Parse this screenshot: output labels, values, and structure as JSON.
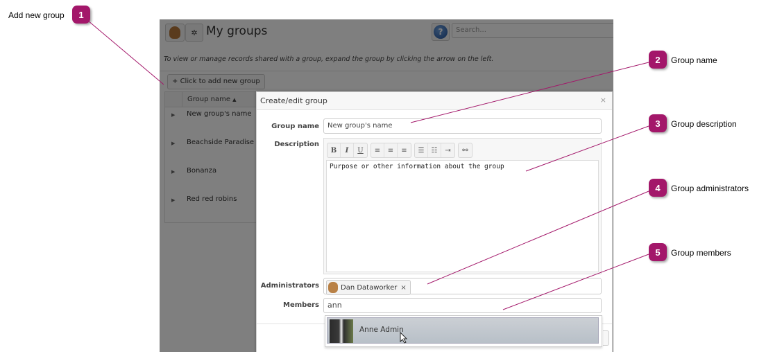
{
  "callouts": [
    {
      "number": "1",
      "label": "Add new group"
    },
    {
      "number": "2",
      "label": "Group name"
    },
    {
      "number": "3",
      "label": "Group description"
    },
    {
      "number": "4",
      "label": "Group administrators"
    },
    {
      "number": "5",
      "label": "Group members"
    }
  ],
  "colors": {
    "callout": "#a3176a",
    "overlay": "rgba(0,0,0,0.5)"
  },
  "header": {
    "title": "My groups",
    "avatar_icon": "dog-avatar-icon",
    "settings_icon": "gear-icon",
    "help_label": "?",
    "search_placeholder": "Search..."
  },
  "hint": "To view or manage records shared with a group, expand the group by clicking the arrow on the left.",
  "add_button": {
    "icon": "+",
    "label": "Click to add new group"
  },
  "groups_table": {
    "column_header": "Group name",
    "sort_indicator": "▲",
    "rows": [
      {
        "name": "New group's name"
      },
      {
        "name": "Beachside Paradise"
      },
      {
        "name": "Bonanza"
      },
      {
        "name": "Red red robins"
      }
    ]
  },
  "dialog": {
    "title": "Create/edit group",
    "close": "×",
    "fields": {
      "group_name_label": "Group name",
      "group_name_value": "New group's name",
      "description_label": "Description",
      "description_value": "Purpose or other information about the group",
      "administrators_label": "Administrators",
      "administrators": [
        {
          "name": "Dan Dataworker",
          "remove": "×"
        }
      ],
      "members_label": "Members",
      "members_value": "ann"
    },
    "toolbar": {
      "bold": "B",
      "italic": "I",
      "underline": "U",
      "align_left": "≡",
      "align_center": "≡",
      "align_right": "≡",
      "bullet_list": "☰",
      "numbered_list": "☷",
      "indent": "⇥",
      "link": "⚯"
    },
    "suggestions": [
      {
        "name": "Anne Admin"
      }
    ]
  }
}
